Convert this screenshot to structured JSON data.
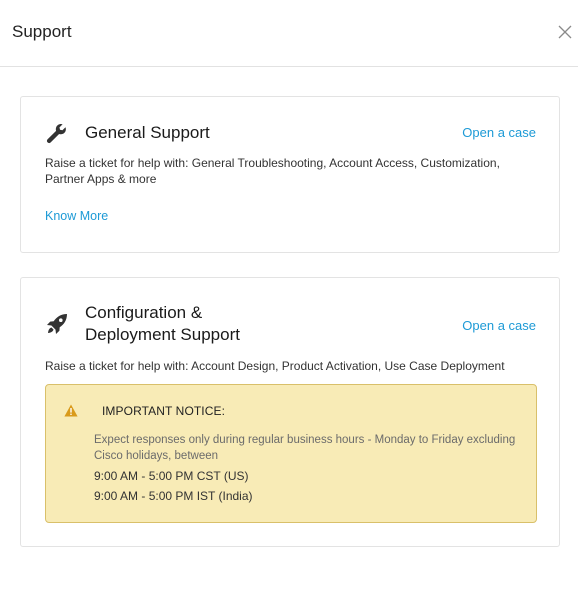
{
  "modal": {
    "title": "Support"
  },
  "cards": [
    {
      "title": "General Support",
      "open_case_label": "Open a case",
      "description": "Raise a ticket for help with: General Troubleshooting, Account Access, Customization, Partner Apps & more",
      "know_more_label": "Know More",
      "icon": "wrench-icon"
    },
    {
      "title": "Configuration & Deployment Support",
      "open_case_label": "Open a case",
      "description": "Raise a ticket for help with: Account Design, Product Activation, Use Case Deployment",
      "icon": "rocket-icon",
      "notice": {
        "title": "IMPORTANT NOTICE:",
        "body": "Expect responses only during regular business hours - Monday to Friday excluding Cisco holidays, between",
        "hours": [
          "9:00 AM - 5:00 PM CST (US)",
          "9:00 AM - 5:00 PM IST (India)"
        ],
        "icon": "warning-icon"
      }
    }
  ],
  "colors": {
    "link": "#1d9ad6",
    "notice_bg": "#f8ebb6",
    "notice_border": "#d9c06a",
    "warning": "#d99a1a"
  }
}
